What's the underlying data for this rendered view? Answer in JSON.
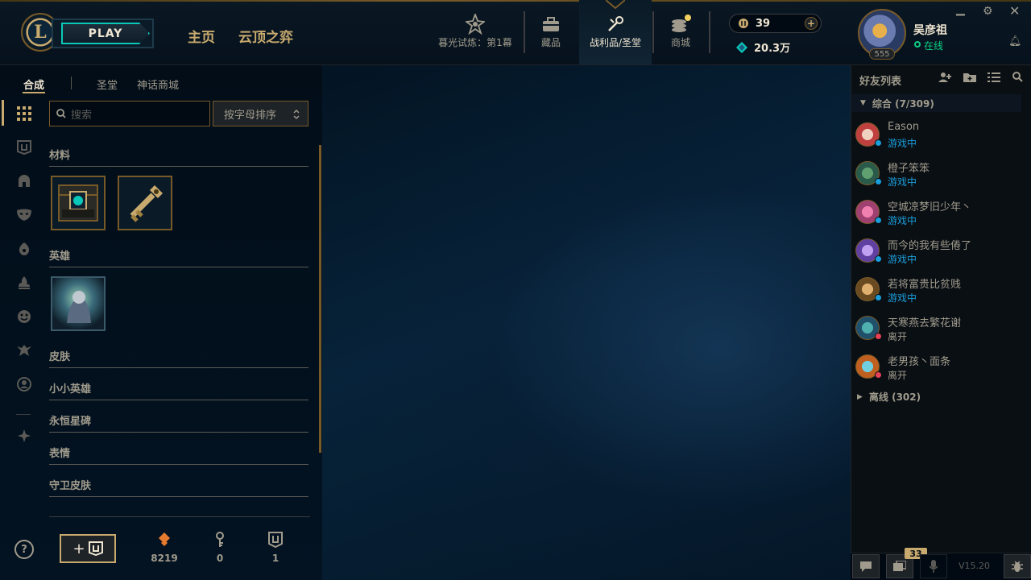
{
  "header": {
    "logo_letter": "L",
    "play_label": "PLAY",
    "nav_main": [
      "主页",
      "云顶之弈"
    ],
    "nav_icons": [
      {
        "label": "暮光试炼：第1幕",
        "icon": "event-pass-icon"
      },
      {
        "label": "藏品",
        "icon": "collection-icon"
      },
      {
        "label": "战利品/圣堂",
        "icon": "loot-icon"
      },
      {
        "label": "商城",
        "icon": "store-icon"
      }
    ],
    "rp_amount": "39",
    "be_amount": "20.3万",
    "username": "吴彦祖",
    "status": "在线",
    "level": "555"
  },
  "subnav": {
    "tabs": [
      "合成",
      "圣堂",
      "神话商城"
    ]
  },
  "search": {
    "placeholder": "搜索",
    "sort_label": "按字母排序"
  },
  "sections": {
    "materials": "材料",
    "champions": "英雄",
    "skins": "皮肤",
    "little_legends": "小小英雄",
    "eternals": "永恒星碑",
    "emotes": "表情",
    "ward_skins": "守卫皮肤"
  },
  "bottom": {
    "help": "?",
    "orange_essence": "8219",
    "keys": "0",
    "chests": "1"
  },
  "friends": {
    "title": "好友列表",
    "group_general": "综合 (7/309)",
    "group_offline": "离线 (302)",
    "list": [
      {
        "name": "Eason",
        "status": "游戏中",
        "state": "ingame"
      },
      {
        "name": "橙子笨笨",
        "status": "游戏中",
        "state": "ingame"
      },
      {
        "name": "空城凉梦旧少年丶",
        "status": "游戏中",
        "state": "ingame"
      },
      {
        "name": "而今的我有些倦了",
        "status": "游戏中",
        "state": "ingame"
      },
      {
        "name": "若将富贵比贫贱",
        "status": "游戏中",
        "state": "ingame"
      },
      {
        "name": "天寒燕去繁花谢",
        "status": "离开",
        "state": "away"
      },
      {
        "name": "老男孩丶面条",
        "status": "离开",
        "state": "away"
      }
    ],
    "notification_count": "33",
    "version": "V15.20"
  },
  "colors": {
    "gold": "#c8aa6e",
    "ingame": "#0ac8b9",
    "ingame_text": "#1a9fdc",
    "away": "#e84057",
    "online": "#0acf83"
  }
}
